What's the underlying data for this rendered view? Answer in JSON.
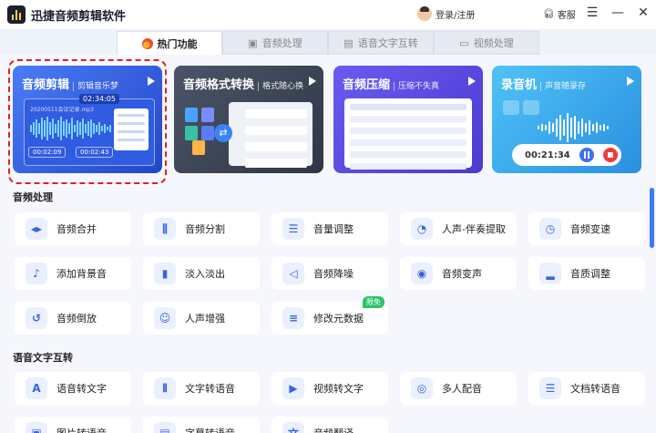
{
  "app": {
    "title": "迅捷音频剪辑软件",
    "login_label": "登录/注册",
    "service_label": "客服"
  },
  "window_buttons": [
    "☰",
    "—",
    "✕"
  ],
  "tabs": [
    {
      "label": "热门功能",
      "active": true
    },
    {
      "label": "音频处理",
      "active": false
    },
    {
      "label": "语音文字互转",
      "active": false
    },
    {
      "label": "视频处理",
      "active": false
    }
  ],
  "feature_cards": [
    {
      "title": "音频剪辑",
      "subtitle": "剪辑音乐梦",
      "time": "02:34:05",
      "filename": "20200511会议记录.mp3",
      "start": "00:02:09",
      "end": "00:02:43"
    },
    {
      "title": "音频格式转换",
      "subtitle": "格式随心换"
    },
    {
      "title": "音频压缩",
      "subtitle": "压缩不失真"
    },
    {
      "title": "录音机",
      "subtitle": "声音随录存",
      "time": "00:21:34"
    }
  ],
  "sections": {
    "audio": "音频处理",
    "speech": "语音文字互转"
  },
  "audio_items": [
    {
      "label": "音频合并",
      "icon": "◂▸"
    },
    {
      "label": "音频分割",
      "icon": "⫼"
    },
    {
      "label": "音量调整",
      "icon": "☰"
    },
    {
      "label": "人声-伴奏提取",
      "icon": "◔"
    },
    {
      "label": "音频变速",
      "icon": "◷"
    },
    {
      "label": "添加背景音",
      "icon": "♪"
    },
    {
      "label": "淡入淡出",
      "icon": "▮"
    },
    {
      "label": "音频降噪",
      "icon": "◁"
    },
    {
      "label": "音频变声",
      "icon": "◉"
    },
    {
      "label": "音质调整",
      "icon": "▂"
    },
    {
      "label": "音频倒放",
      "icon": "↺"
    },
    {
      "label": "人声增强",
      "icon": "☺"
    },
    {
      "label": "修改元数据",
      "icon": "≡",
      "badge": "限免"
    }
  ],
  "speech_items": [
    {
      "label": "语音转文字",
      "icon": "A"
    },
    {
      "label": "文字转语音",
      "icon": "⦀"
    },
    {
      "label": "视频转文字",
      "icon": "▶"
    },
    {
      "label": "多人配音",
      "icon": "◎"
    },
    {
      "label": "文档转语音",
      "icon": "☰"
    },
    {
      "label": "图片转语音",
      "icon": "▣"
    },
    {
      "label": "字幕转语音",
      "icon": "▤"
    },
    {
      "label": "音频翻译",
      "icon": "文"
    }
  ],
  "colors": {
    "accent": "#3c7bf3",
    "highlight_dash": "#e02020",
    "badge": "#2dc36a"
  }
}
